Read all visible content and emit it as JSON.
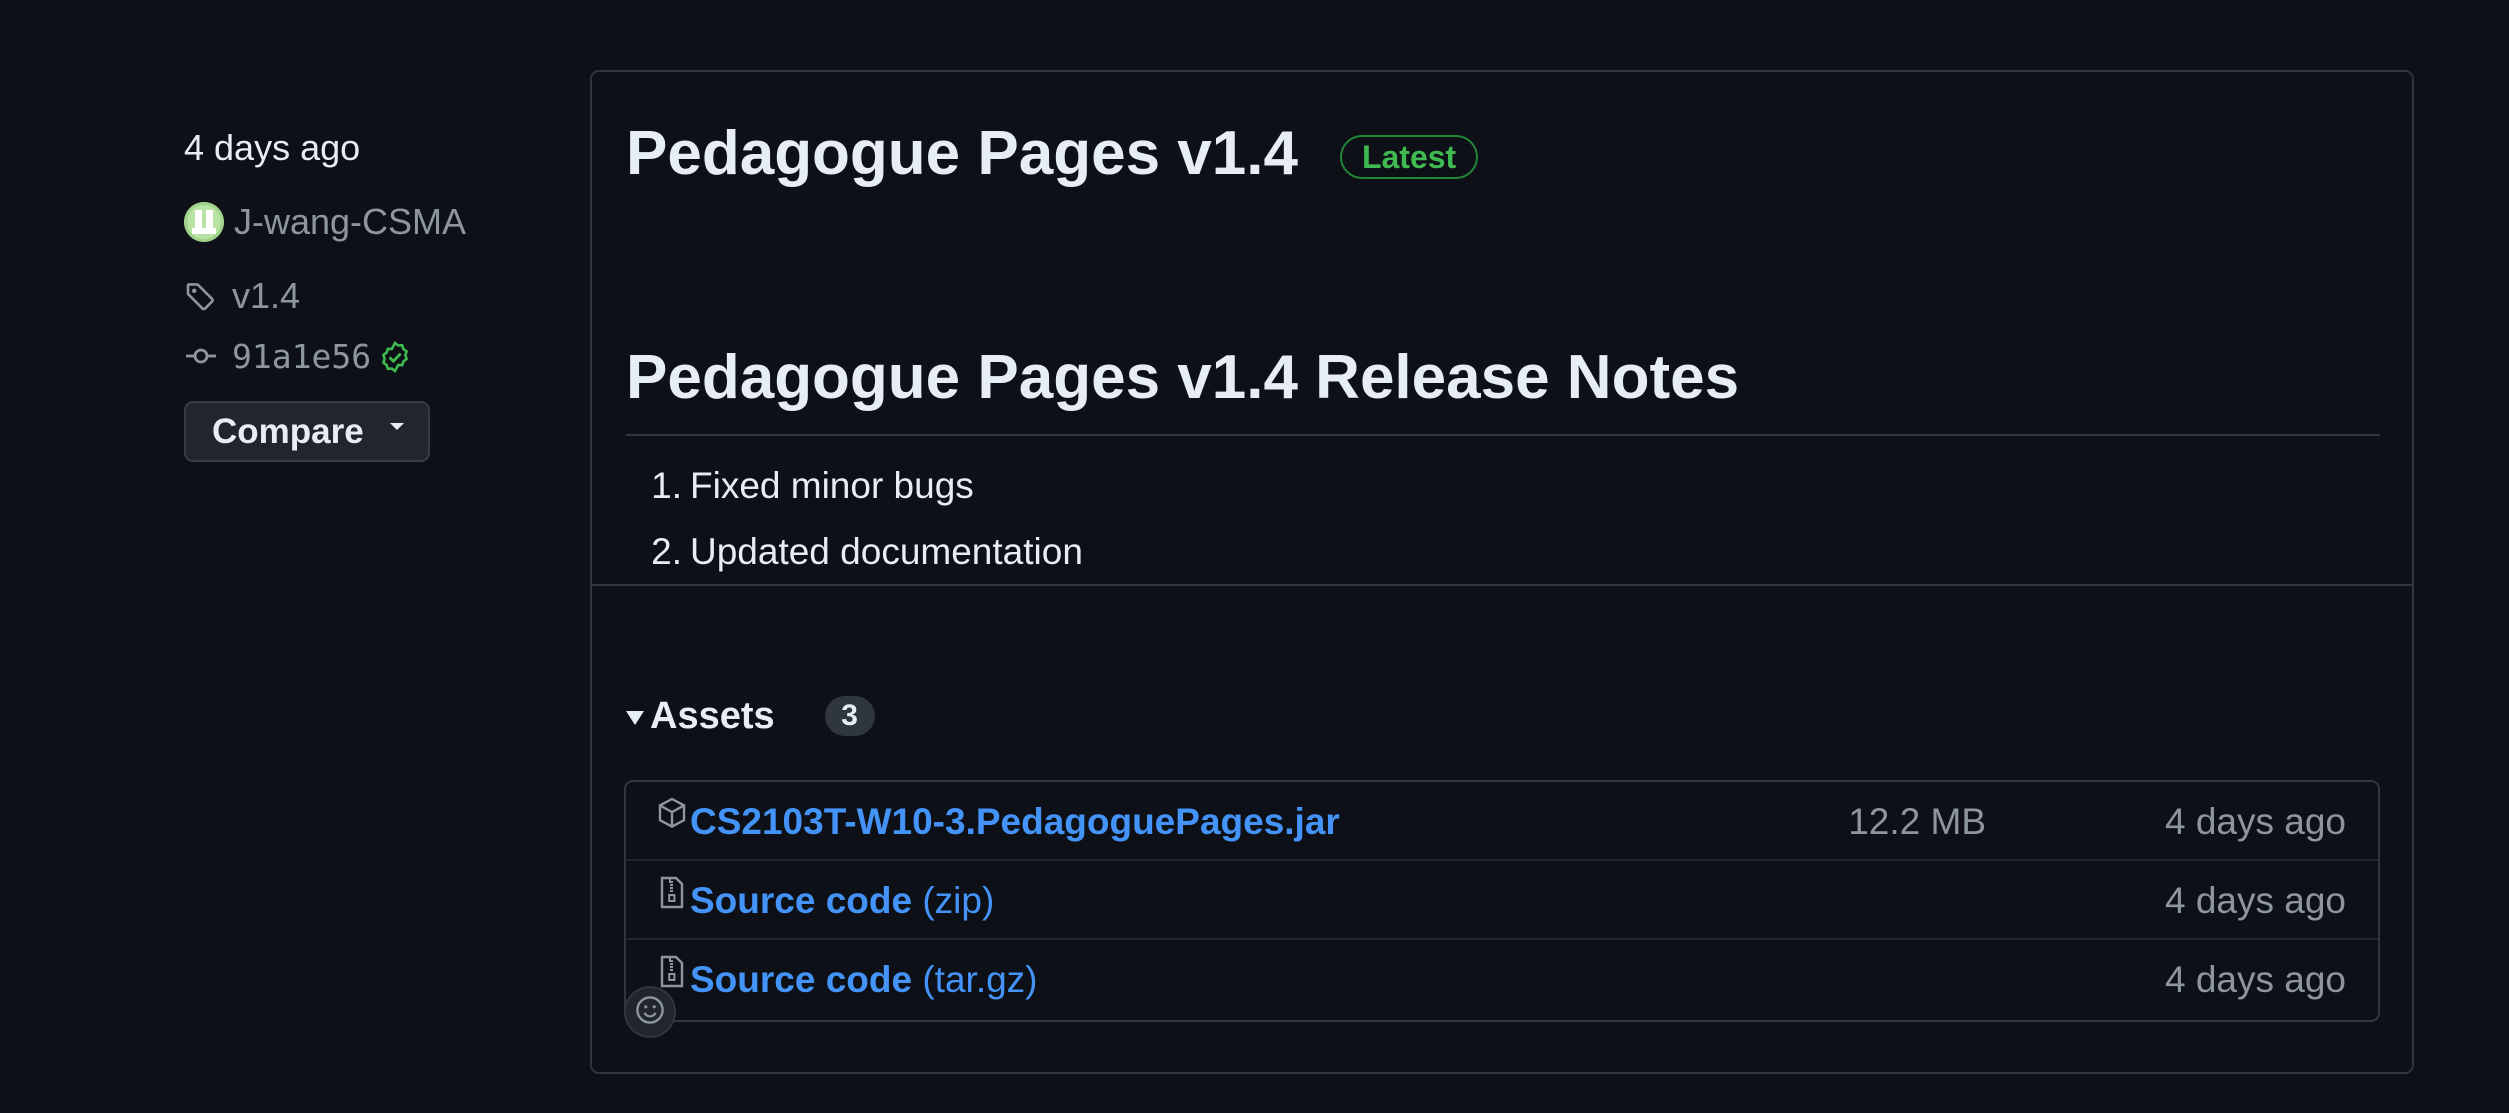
{
  "meta": {
    "date": "4 days ago",
    "author": "J-wang-CSMA",
    "tag": "v1.4",
    "commit": "91a1e56",
    "compare_label": "Compare"
  },
  "release": {
    "title": "Pedagogue Pages v1.4",
    "badge": "Latest",
    "notes_heading": "Pedagogue Pages v1.4 Release Notes",
    "notes": [
      {
        "num": "1.",
        "text": "Fixed minor bugs"
      },
      {
        "num": "2.",
        "text": "Updated documentation"
      }
    ]
  },
  "assets": {
    "label": "Assets",
    "count": "3",
    "items": [
      {
        "name": "CS2103T-W10-3.PedagoguePages.jar",
        "suffix": "",
        "size": "12.2 MB",
        "date": "4 days ago",
        "icon": "package-icon"
      },
      {
        "name": "Source code",
        "suffix": " (zip)",
        "size": "",
        "date": "4 days ago",
        "icon": "file-zip-icon"
      },
      {
        "name": "Source code",
        "suffix": " (tar.gz)",
        "size": "",
        "date": "4 days ago",
        "icon": "file-zip-icon"
      }
    ]
  },
  "colors": {
    "background": "#0d1117",
    "border": "#30363d",
    "link": "#4493f8",
    "success": "#3fb950",
    "muted": "#8d96a0"
  }
}
